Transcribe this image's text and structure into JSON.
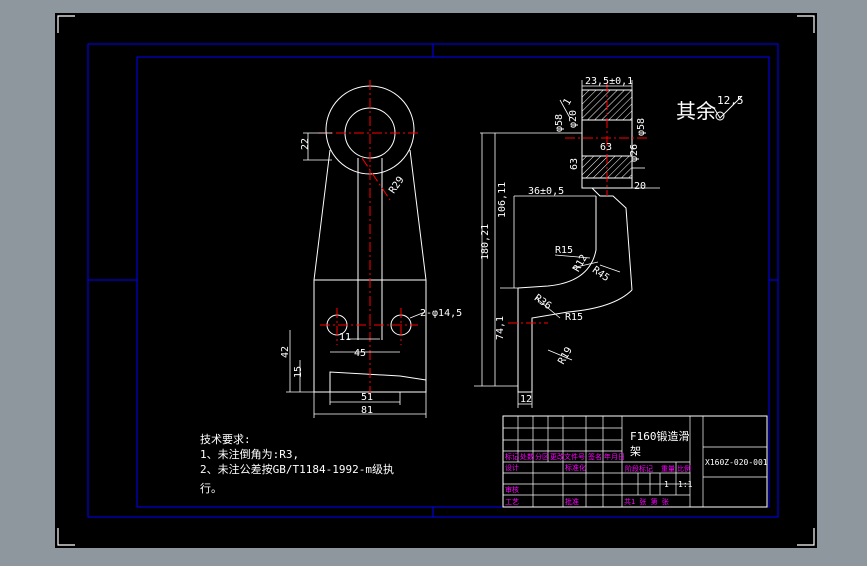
{
  "colors": {
    "app_bg": "#8e969e",
    "paper": "#000000",
    "frame": "#0000ff",
    "line": "#ffffff",
    "center": "#ff0000",
    "dim": "#00ff00",
    "text": "#ffffff",
    "title_text": "#ff00ff"
  },
  "dims": {
    "d22": "22",
    "d29": "R29",
    "d106": "106,11",
    "d180": "180,21",
    "d74": "74,1",
    "d42": "42",
    "d15": "15",
    "d11": "11",
    "d45": "45",
    "d51": "51",
    "d81": "81",
    "d_hole": "2-φ14,5",
    "d_top": "23,5±0,1",
    "d_phi58a": "φ58",
    "d_phi58b": "φ58",
    "d_phi20": "φ20",
    "d_63a": "63",
    "d_63b": "63",
    "d_phi26": "φ26",
    "d_1": "1",
    "d_36": "36±0,5",
    "d_20": "20",
    "r15": "R15",
    "r12": "R12",
    "r45": "R45",
    "r36": "R36",
    "r15b": "R15",
    "r19": "R19",
    "d12": "12"
  },
  "finish": {
    "label": "其余",
    "value": "12,5"
  },
  "notes": {
    "heading": "技术要求:",
    "line1": "1、未注倒角为:R3,",
    "line2": "2、未注公差按GB/T1184-1992-m级执",
    "line3": "行。"
  },
  "title_block": {
    "part_name_1": "F160锻造滑",
    "part_name_2": "架",
    "code": "X160Z-020-001",
    "quantity": "1",
    "scale": "1:1",
    "row_labels": [
      "标记",
      "设计",
      "审核",
      "工艺"
    ],
    "col_labels": [
      "标记",
      "处数",
      "分区",
      "更改文件号",
      "签名",
      "年月日"
    ],
    "std_label": "标准化",
    "approve_label": "批准",
    "stage_labels": [
      "阶段标记",
      "重量",
      "比例"
    ],
    "sheet_label": "共1 张 第 张"
  }
}
